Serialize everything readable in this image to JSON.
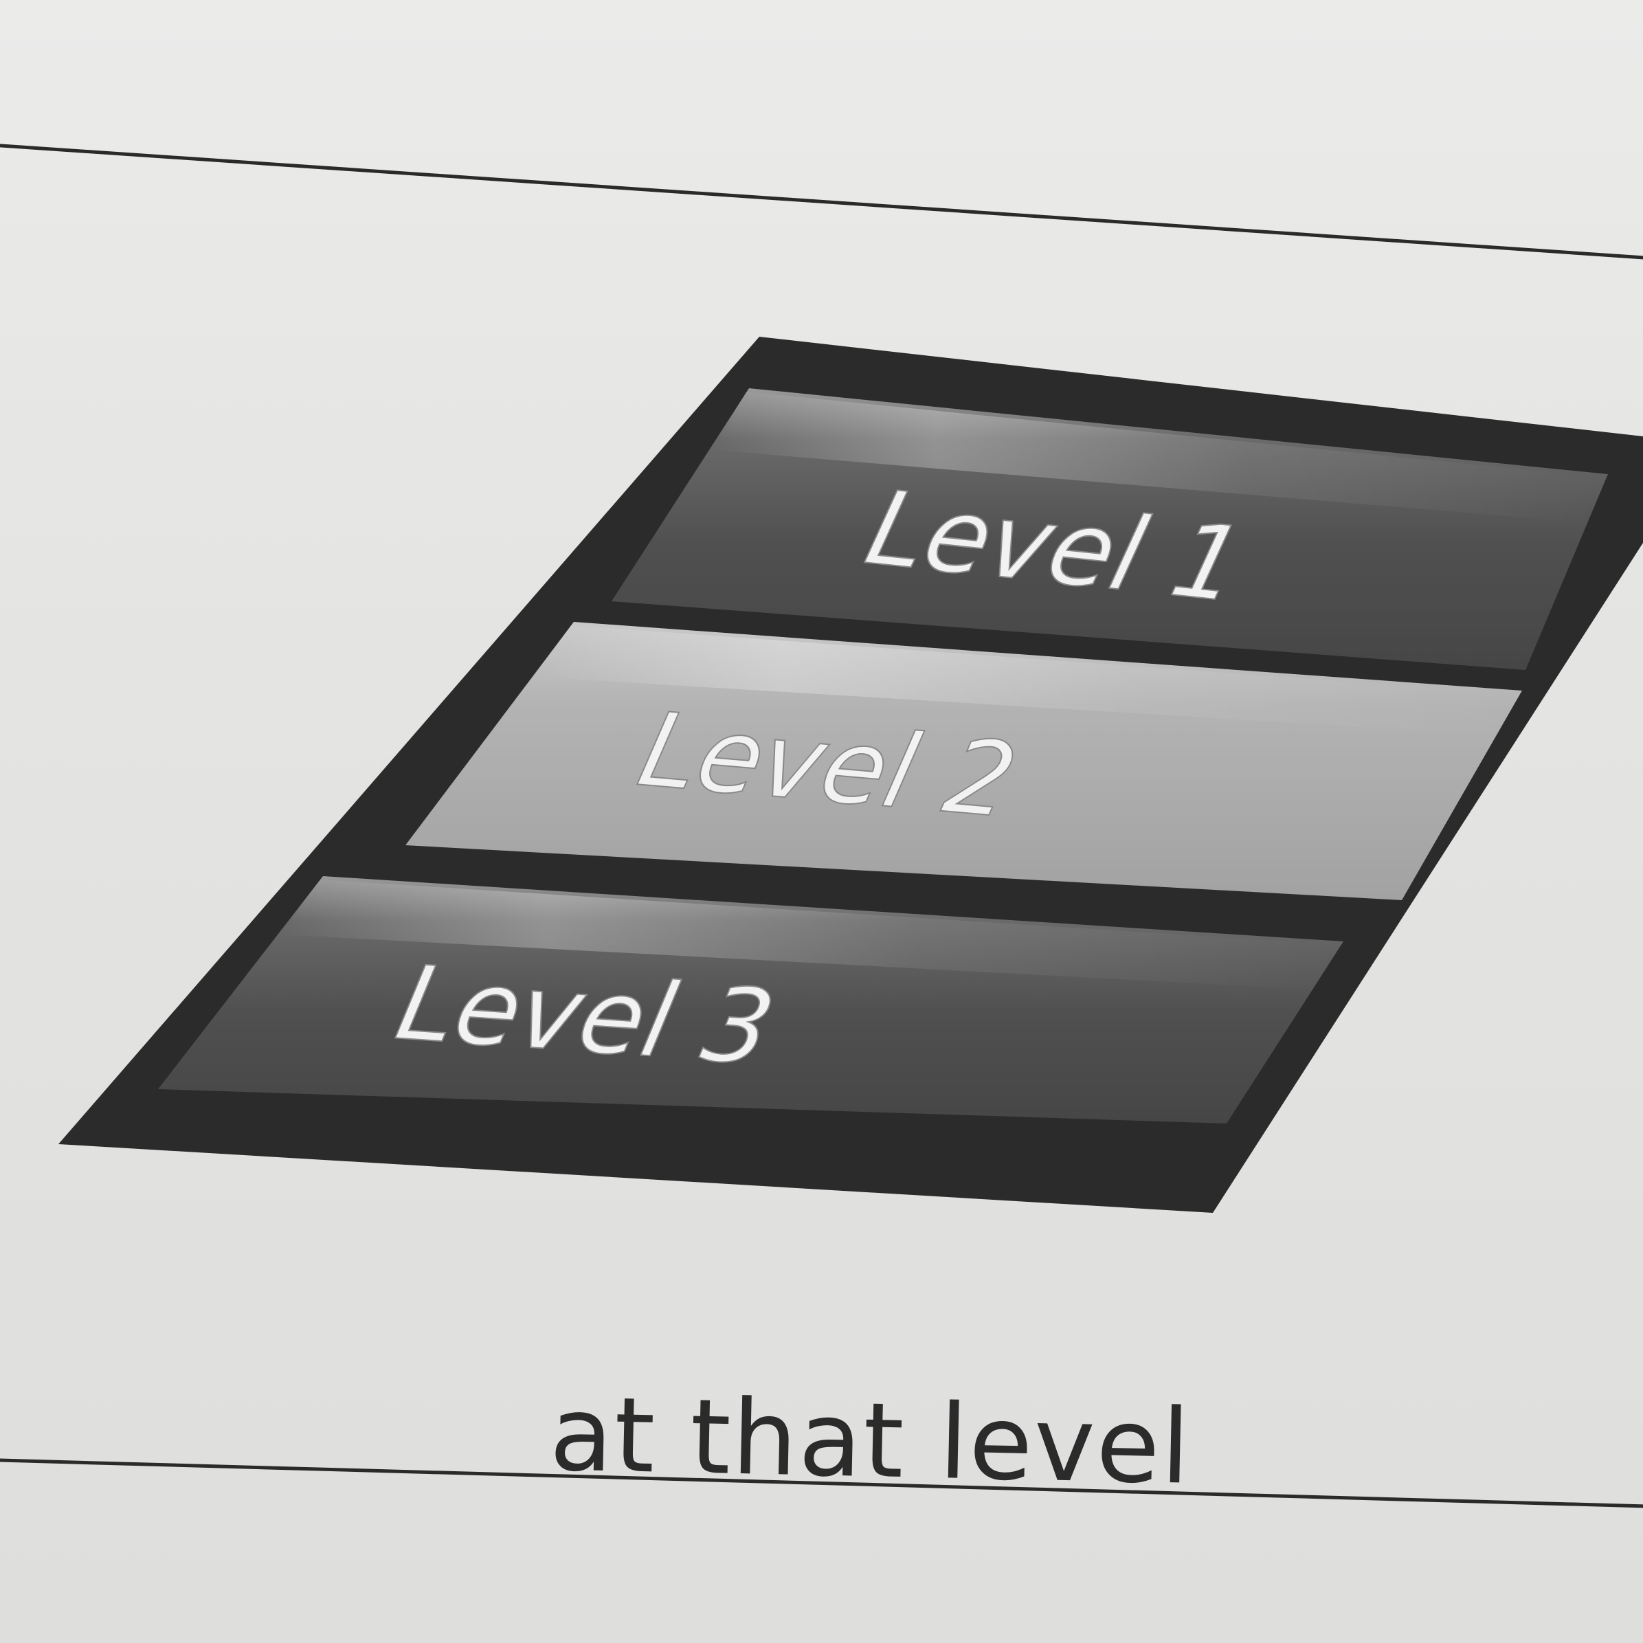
{
  "menu": {
    "items": [
      {
        "label": "Level 1"
      },
      {
        "label": "Level 2"
      },
      {
        "label": "Level 3"
      }
    ]
  },
  "caption": "at that level"
}
